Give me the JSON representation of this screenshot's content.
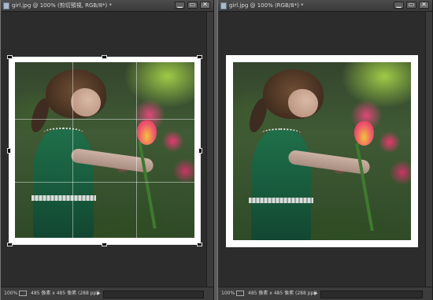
{
  "windows": [
    {
      "title": "girl.jpg @ 100% (剪切預視, RGB/8*) *",
      "status": {
        "zoom": "100%",
        "info": "485 像素 x 485 像素 (288 ppi)",
        "arrow": "▶"
      },
      "mode": "crop-preview"
    },
    {
      "title": "girl.jpg @ 100% (RGB/8*) *",
      "status": {
        "zoom": "100%",
        "info": "485 像素 x 485 像素 (288 ppi)",
        "arrow": "▶"
      },
      "mode": "final"
    }
  ],
  "icons": {
    "minimize": "minimize-icon",
    "maximize": "maximize-icon",
    "close": "close-icon",
    "document": "document-icon"
  },
  "colors": {
    "workspace": "#2c2c2c",
    "titlebar": "#3f3f3f",
    "photo_border": "#ffffff"
  }
}
